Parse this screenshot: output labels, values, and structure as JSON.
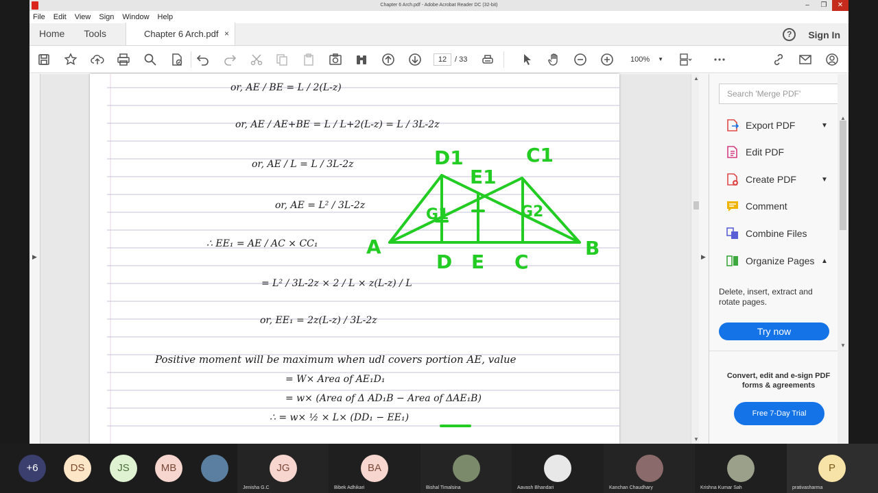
{
  "window": {
    "title": "Chapter 6 Arch.pdf - Adobe Acrobat Reader DC (32-bit)"
  },
  "menu": [
    "File",
    "Edit",
    "View",
    "Sign",
    "Window",
    "Help"
  ],
  "tabs": {
    "home": "Home",
    "tools": "Tools",
    "doc": "Chapter 6 Arch.pdf",
    "close": "×",
    "sign_in": "Sign In",
    "help": "?"
  },
  "toolbar": {
    "page_current": "12",
    "page_total": "/ 33",
    "zoom": "100%"
  },
  "right_panel": {
    "search_placeholder": "Search 'Merge PDF'",
    "tools": [
      {
        "label": "Export PDF",
        "icon": "export-pdf-icon",
        "color": "#e04a4a",
        "chevron": "⌄"
      },
      {
        "label": "Edit PDF",
        "icon": "edit-pdf-icon",
        "color": "#d63d82",
        "chevron": ""
      },
      {
        "label": "Create PDF",
        "icon": "create-pdf-icon",
        "color": "#e04a4a",
        "chevron": "⌄"
      },
      {
        "label": "Comment",
        "icon": "comment-icon",
        "color": "#f0b400",
        "chevron": ""
      },
      {
        "label": "Combine Files",
        "icon": "combine-files-icon",
        "color": "#5b5fd6",
        "chevron": ""
      },
      {
        "label": "Organize Pages",
        "icon": "organize-pages-icon",
        "color": "#3da83d",
        "chevron": "⌃"
      }
    ],
    "description": "Delete, insert, extract and rotate pages.",
    "try_now": "Try now",
    "promo": "Convert, edit and e-sign PDF forms & agreements",
    "trial": "Free 7-Day Trial",
    "accent": "#1473e6"
  },
  "document": {
    "lines": [
      "or,  AE / BE  =  L / 2(L-z)",
      "or,  AE / AE+BE  =  L / L+2(L-z)  =  L / 3L-2z",
      "or,  AE / L  =  L / 3L-2z",
      "or,  AE = L² / 3L-2z",
      "∴ EE₁ = AE / AC × CC₁",
      "= L² / 3L-2z  ×  2 / L  ×  z(L-z) / L",
      "or,  EE₁ = 2z(L-z) / 3L-2z",
      "Positive moment will be maximum when udl covers portion AE, value",
      "= W× Area of AE₁D₁",
      "= w× (Area of Δ AD₁B − Area of ΔAE₁B)",
      "∴ = w× ½ × L× (DD₁ − EE₁)"
    ],
    "diagram_labels": {
      "a": "A",
      "b": "B",
      "c": "C",
      "d": "D",
      "e": "E",
      "c1": "C1",
      "d1": "D1",
      "e1": "E1",
      "g1": "G1",
      "g2": "G2"
    },
    "ink_color": "#22cc22"
  },
  "participants": [
    {
      "initials": "+6",
      "name": "",
      "bg": "#3b3f6e",
      "fg": "#ffffff"
    },
    {
      "initials": "DS",
      "name": "",
      "bg": "#fde6c8",
      "fg": "#7a4a2a"
    },
    {
      "initials": "JS",
      "name": "",
      "bg": "#dff2d2",
      "fg": "#4a6a3a"
    },
    {
      "initials": "MB",
      "name": "",
      "bg": "#f7d6cf",
      "fg": "#7a4a3a"
    },
    {
      "initials": "",
      "name": "",
      "bg": "#5a7fa0",
      "fg": "#ffffff"
    },
    {
      "initials": "JG",
      "name": "Jenisha G.C",
      "bg": "#f7d6cf",
      "fg": "#7a4a3a"
    },
    {
      "initials": "BA",
      "name": "Bibek Adhikari",
      "bg": "#f7d6cf",
      "fg": "#7a4a3a"
    },
    {
      "initials": "",
      "name": "Bishal Timalsina",
      "bg": "#7a8a6a",
      "fg": "#ffffff"
    },
    {
      "initials": "",
      "name": "Aavash Bhandari",
      "bg": "#e8e8e8",
      "fg": "#333333"
    },
    {
      "initials": "",
      "name": "Kanchan Chaudhary",
      "bg": "#8a6a6a",
      "fg": "#ffffff"
    },
    {
      "initials": "",
      "name": "Krishna Kumar Sah",
      "bg": "#9aa08a",
      "fg": "#ffffff"
    },
    {
      "initials": "P",
      "name": "prativasharma",
      "bg": "#f7e2a8",
      "fg": "#7a5a1a"
    }
  ]
}
